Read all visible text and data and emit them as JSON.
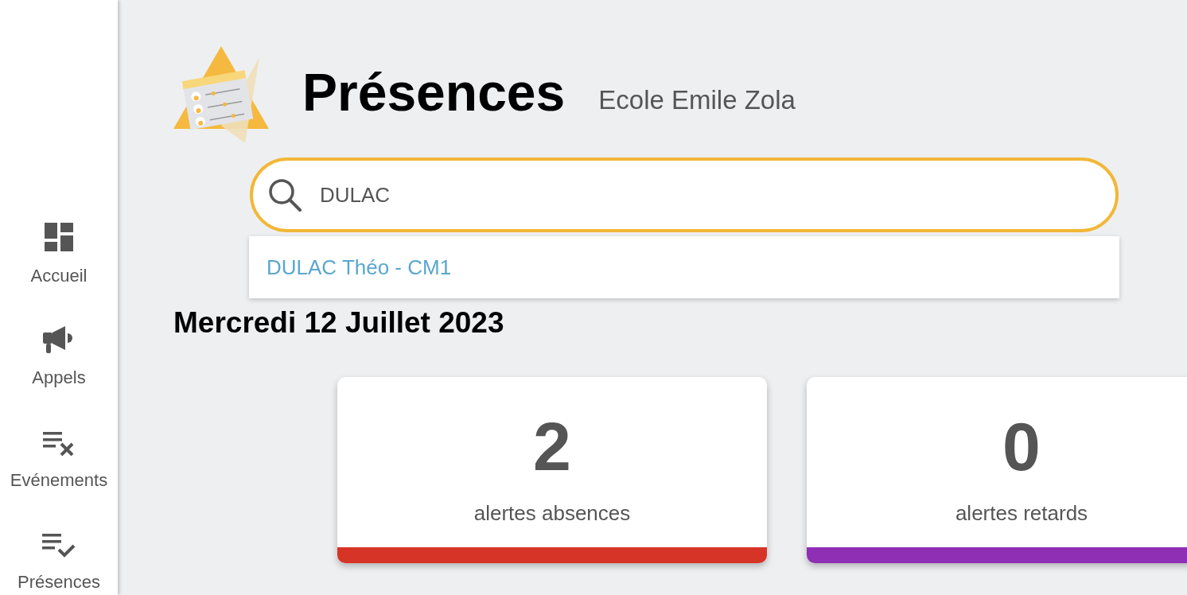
{
  "sidebar": {
    "items": [
      {
        "kind": "dashboard",
        "label": "Accueil"
      },
      {
        "kind": "megaphone",
        "label": "Appels"
      },
      {
        "kind": "list-x",
        "label": "Evénements"
      },
      {
        "kind": "list-check",
        "label": "Présences"
      }
    ]
  },
  "header": {
    "title": "Présences",
    "subtitle": "Ecole Emile Zola"
  },
  "search": {
    "value": "DULAC",
    "suggestions": [
      "DULAC Théo - CM1"
    ]
  },
  "date_heading": "Mercredi 12 Juillet 2023",
  "cards": [
    {
      "value": "2",
      "label": "alertes absences",
      "color": "#d63426"
    },
    {
      "value": "0",
      "label": "alertes retards",
      "color": "#8e2fb4"
    }
  ]
}
